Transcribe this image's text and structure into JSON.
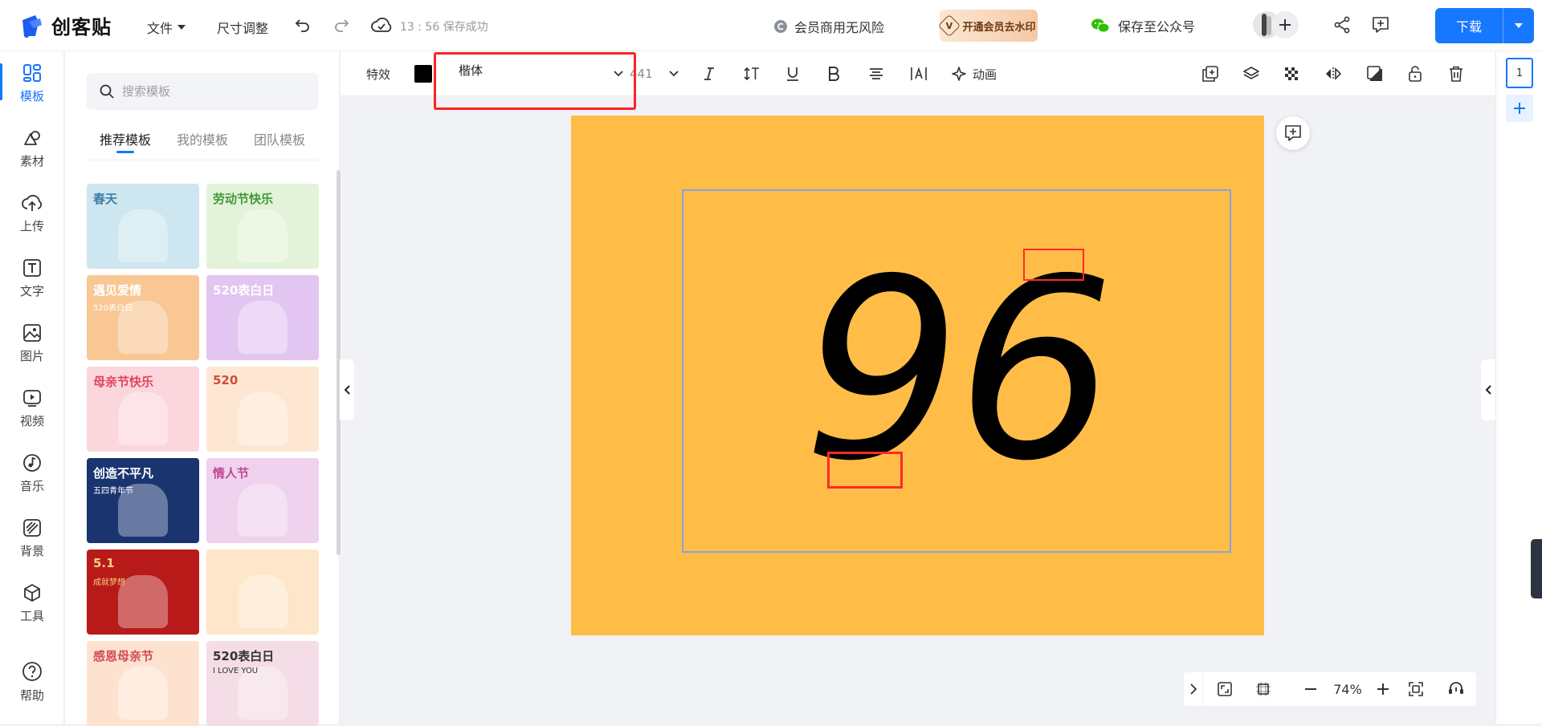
{
  "app": {
    "logo_text": "创客贴"
  },
  "topbar": {
    "file_menu": "文件",
    "resize": "尺寸调整",
    "save_status": "13 : 56 保存成功",
    "commercial": "会员商用无风险",
    "vip_badge": "开通会员去水印",
    "vip_letter": "V",
    "save_wechat": "保存至公众号",
    "download": "下载"
  },
  "rail": {
    "items": [
      {
        "label": "模板",
        "icon": "template-icon",
        "active": true
      },
      {
        "label": "素材",
        "icon": "shapes-icon"
      },
      {
        "label": "上传",
        "icon": "upload-cloud-icon"
      },
      {
        "label": "文字",
        "icon": "text-icon"
      },
      {
        "label": "图片",
        "icon": "image-icon"
      },
      {
        "label": "视频",
        "icon": "video-icon"
      },
      {
        "label": "音乐",
        "icon": "music-icon"
      },
      {
        "label": "背景",
        "icon": "background-icon"
      },
      {
        "label": "工具",
        "icon": "tools-cube-icon"
      }
    ],
    "help": "帮助"
  },
  "panel": {
    "search_placeholder": "搜索模板",
    "tabs": [
      "推荐模板",
      "我的模板",
      "团队模板"
    ],
    "templates": [
      {
        "title": "春天",
        "sub": "",
        "bg": "#cde6ef",
        "fg": "#3b7da8"
      },
      {
        "title": "劳动节快乐",
        "sub": "",
        "bg": "#e3f3d9",
        "fg": "#3f9a3a"
      },
      {
        "title": "遇见爱情",
        "sub": "520表白日",
        "bg": "#f8c793",
        "fg": "#ffffff"
      },
      {
        "title": "520表白日",
        "sub": "",
        "bg": "#e2c6f1",
        "fg": "#ffffff"
      },
      {
        "title": "母亲节快乐",
        "sub": "",
        "bg": "#fbd6dd",
        "fg": "#e0465f"
      },
      {
        "title": "520",
        "sub": "",
        "bg": "#fde7d2",
        "fg": "#d24c3b"
      },
      {
        "title": "创造不平凡",
        "sub": "五四青年节",
        "bg": "#1a3470",
        "fg": "#ffffff"
      },
      {
        "title": "情人节",
        "sub": "",
        "bg": "#efd2ee",
        "fg": "#c04791"
      },
      {
        "title": "5.1",
        "sub": "成就梦想",
        "bg": "#b81a1a",
        "fg": "#f5d07a"
      },
      {
        "title": "",
        "sub": "",
        "bg": "#fde6c9",
        "fg": "#d24c3b"
      },
      {
        "title": "感恩母亲节",
        "sub": "",
        "bg": "#fde3cf",
        "fg": "#d24c5c"
      },
      {
        "title": "520表白日",
        "sub": "I LOVE YOU",
        "bg": "#f4dde6",
        "fg": "#333333"
      }
    ]
  },
  "toolbar": {
    "effects": "特效",
    "text_color": "#000000",
    "font_name": "楷体",
    "font_size": "441",
    "animation": "动画"
  },
  "canvas": {
    "background_color": "#ffbd48",
    "text": "96",
    "page_number": "1"
  },
  "zoombar": {
    "zoom": "74%"
  },
  "colors": {
    "accent": "#1677ff",
    "highlight": "#ff2222"
  }
}
